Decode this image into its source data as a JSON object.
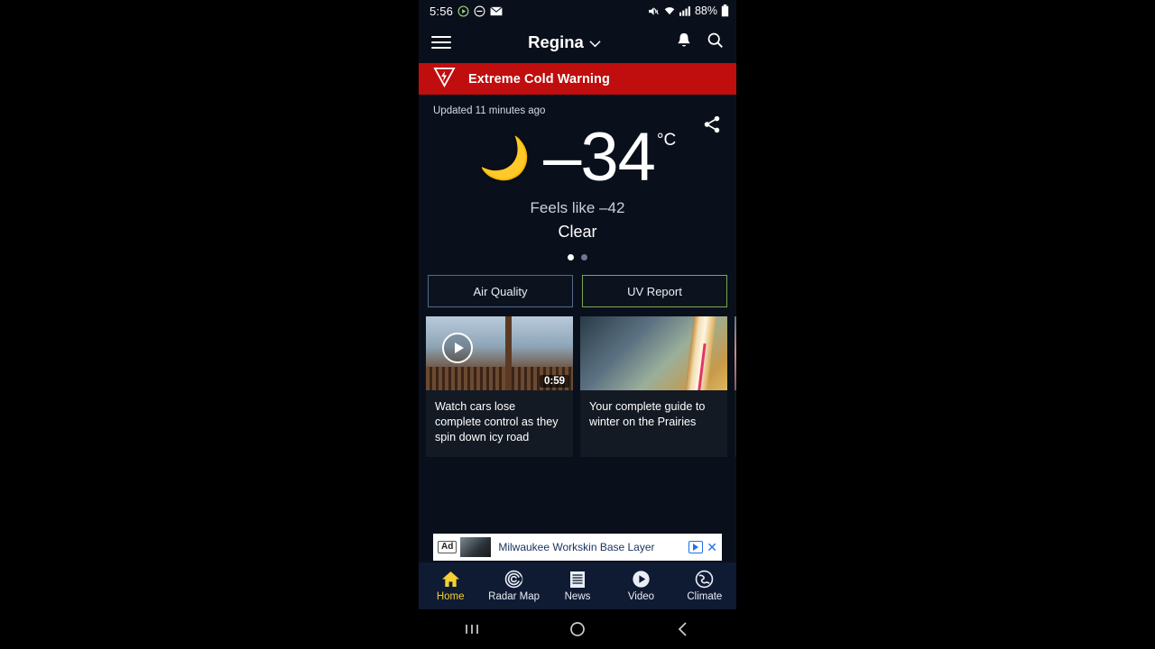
{
  "status_bar": {
    "time": "5:56",
    "left_icons": [
      "play-circle-icon",
      "do-not-disturb-icon",
      "mail-icon"
    ],
    "mute_icon": "mute-icon",
    "wifi_icon": "wifi-icon",
    "signal_icon": "cellular-signal-icon",
    "battery_percent": "88%",
    "battery_icon": "battery-icon"
  },
  "app_bar": {
    "menu_icon": "hamburger-menu-icon",
    "location": "Regina",
    "chevron": "˅",
    "bell_icon": "bell-icon",
    "search_icon": "search-icon"
  },
  "alert": {
    "icon": "severe-weather-warning-icon",
    "text": "Extreme Cold Warning",
    "color": "#c00d0d"
  },
  "current": {
    "updated": "Updated 11 minutes ago",
    "share_icon": "share-icon",
    "condition_icon": "crescent-moon-icon",
    "temperature": "–34",
    "unit": "°C",
    "feels_like": "Feels like –42",
    "condition": "Clear",
    "page_dots": 2,
    "active_dot": 1
  },
  "chips": {
    "air_quality": "Air Quality",
    "uv_report": "UV Report",
    "uv_border_color": "#7aa84f",
    "aq_border_color": "#53698c"
  },
  "cards": [
    {
      "title": "Watch cars lose complete control as they spin down icy road",
      "has_play": true,
      "duration": "0:59",
      "thumb": "icy-road-cars-thumbnail"
    },
    {
      "title": "Your complete guide to winter on the Prairies",
      "has_play": false,
      "duration": "",
      "thumb": "frosted-thermometer-thumbnail"
    },
    {
      "title": "",
      "has_play": false,
      "duration": "",
      "thumb": "person-portrait-thumbnail"
    }
  ],
  "ad": {
    "badge": "Ad",
    "text": "Milwaukee Workskin Base Layer",
    "adchoices_icon": "adchoices-icon",
    "close_icon": "close-icon"
  },
  "bottom_nav": [
    {
      "label": "Home",
      "icon": "home-icon",
      "active": true
    },
    {
      "label": "Radar Map",
      "icon": "radar-icon",
      "active": false
    },
    {
      "label": "News",
      "icon": "news-icon",
      "active": false
    },
    {
      "label": "Video",
      "icon": "video-play-icon",
      "active": false
    },
    {
      "label": "Climate",
      "icon": "globe-icon",
      "active": false
    }
  ],
  "system_nav": {
    "recents": "recents-icon",
    "home": "home-circle-icon",
    "back": "back-icon"
  }
}
